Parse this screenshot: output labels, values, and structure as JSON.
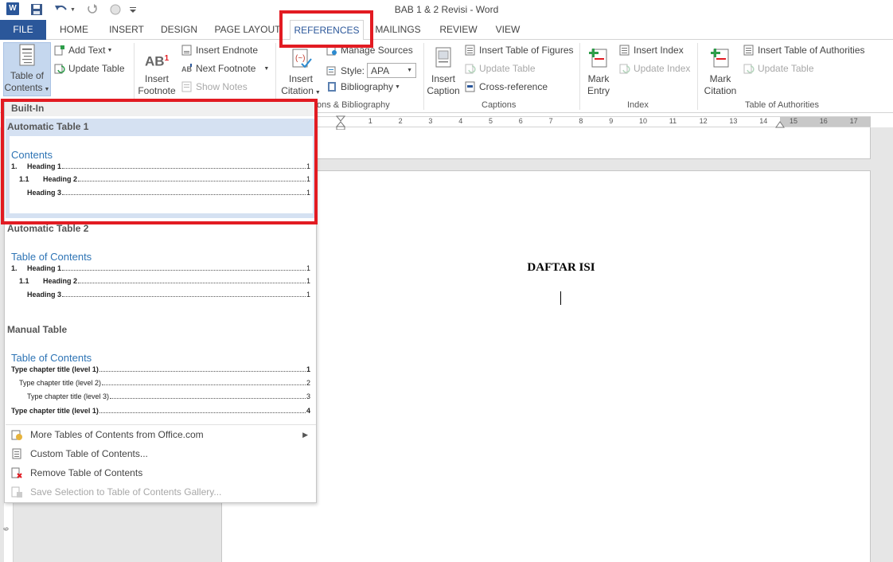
{
  "window": {
    "title": "BAB 1 & 2 Revisi - Word",
    "logo_letter": "W"
  },
  "tabs": [
    {
      "label": "FILE"
    },
    {
      "label": "HOME"
    },
    {
      "label": "INSERT"
    },
    {
      "label": "DESIGN"
    },
    {
      "label": "PAGE LAYOUT"
    },
    {
      "label": "REFERENCES"
    },
    {
      "label": "MAILINGS"
    },
    {
      "label": "REVIEW"
    },
    {
      "label": "VIEW"
    }
  ],
  "ribbon": {
    "toc": {
      "line1": "Table of",
      "line2": "Contents"
    },
    "add_text": "Add Text",
    "update_table": "Update Table",
    "insert_footnote": {
      "line1": "Insert",
      "line2": "Footnote"
    },
    "footnote_icon_text": "AB",
    "footnote_icon_sup": "1",
    "insert_endnote": "Insert Endnote",
    "next_footnote": "Next Footnote",
    "show_notes": "Show Notes",
    "insert_citation": {
      "line1": "Insert",
      "line2": "Citation"
    },
    "manage_sources": "Manage Sources",
    "style_label": "Style:",
    "style_value": "APA",
    "bibliography": "Bibliography",
    "citations_group": "ons & Bibliography",
    "insert_caption": {
      "line1": "Insert",
      "line2": "Caption"
    },
    "insert_table_of_figures": "Insert Table of Figures",
    "update_table_captions": "Update Table",
    "cross_reference": "Cross-reference",
    "captions_group": "Captions",
    "mark_entry": {
      "line1": "Mark",
      "line2": "Entry"
    },
    "insert_index": "Insert Index",
    "update_index": "Update Index",
    "index_group": "Index",
    "mark_citation": {
      "line1": "Mark",
      "line2": "Citation"
    },
    "insert_table_of_authorities": "Insert Table of Authorities",
    "update_table_authorities": "Update Table",
    "authorities_group": "Table of Authorities"
  },
  "ruler": {
    "ticks": [
      "1",
      "2",
      "3",
      "4",
      "5",
      "6",
      "7",
      "8",
      "9",
      "10",
      "11",
      "12",
      "13",
      "14",
      "15",
      "16",
      "17"
    ]
  },
  "document": {
    "heading": "DAFTAR ISI"
  },
  "gallery": {
    "section": "Built-In",
    "items": [
      {
        "title": "Automatic Table 1",
        "preview_title": "Contents",
        "rows": [
          {
            "num": "1.",
            "label": "Heading 1",
            "page": "1"
          },
          {
            "num": "1.1",
            "label": "Heading 2",
            "page": "1"
          },
          {
            "num": "",
            "label": "Heading 3",
            "page": "1"
          }
        ]
      },
      {
        "title": "Automatic Table 2",
        "preview_title": "Table of Contents",
        "rows": [
          {
            "num": "1.",
            "label": "Heading 1",
            "page": "1"
          },
          {
            "num": "1.1",
            "label": "Heading 2",
            "page": "1"
          },
          {
            "num": "",
            "label": "Heading 3",
            "page": "1"
          }
        ]
      },
      {
        "title": "Manual Table",
        "preview_title": "Table of Contents",
        "rows": [
          {
            "label": "Type chapter title (level 1)",
            "page": "1"
          },
          {
            "label": "Type chapter title (level 2)",
            "page": "2"
          },
          {
            "label": "Type chapter title (level 3)",
            "page": "3"
          },
          {
            "label": "Type chapter title (level 1)",
            "page": "4"
          }
        ]
      }
    ],
    "menu": [
      {
        "label": "More Tables of Contents from Office.com"
      },
      {
        "label": "Custom Table of Contents..."
      },
      {
        "label": "Remove Table of Contents"
      },
      {
        "label": "Save Selection to Table of Contents Gallery..."
      }
    ]
  },
  "colors": {
    "accent": "#2b579a",
    "highlight_box": "#e21b22",
    "preview_title": "#2e74b5",
    "selected_item": "#d5e1f2"
  }
}
